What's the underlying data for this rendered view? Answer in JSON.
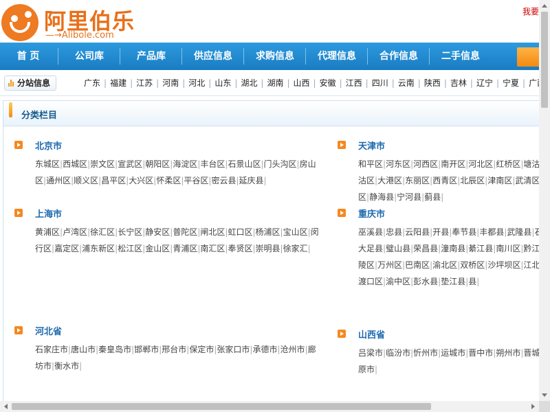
{
  "header": {
    "logo_cn": "阿里伯乐",
    "logo_en": "Alibole.com",
    "logo_arrow": "—→",
    "top_link": "我要"
  },
  "nav": {
    "items": [
      {
        "label": "首 页"
      },
      {
        "label": "公司库"
      },
      {
        "label": "产品库"
      },
      {
        "label": "供应信息"
      },
      {
        "label": "求购信息"
      },
      {
        "label": "代理信息"
      },
      {
        "label": "合作信息"
      },
      {
        "label": "二手信息"
      }
    ]
  },
  "region_bar": {
    "label": "分站信息",
    "regions": [
      "广东",
      "福建",
      "江苏",
      "河南",
      "河北",
      "山东",
      "湖北",
      "湖南",
      "山西",
      "安徽",
      "江西",
      "四川",
      "云南",
      "陕西",
      "吉林",
      "辽宁",
      "宁夏",
      "广西"
    ]
  },
  "panel": {
    "title": "分类栏目",
    "blocks": [
      {
        "name": "北京市",
        "links": [
          "东城区",
          "西城区",
          "崇文区",
          "宣武区",
          "朝阳区",
          "海淀区",
          "丰台区",
          "石景山区",
          "门头沟区",
          "房山区",
          "通州区",
          "顺义区",
          "昌平区",
          "大兴区",
          "怀柔区",
          "平谷区",
          "密云县",
          "延庆县"
        ]
      },
      {
        "name": "天津市",
        "links": [
          "和平区",
          "河东区",
          "河西区",
          "南开区",
          "河北区",
          "红桥区",
          "塘沽区",
          "汉沽区",
          "大港区",
          "东丽区",
          "西青区",
          "北辰区",
          "津南区",
          "武清区",
          "宝坻区",
          "静海县",
          "宁河县",
          "蓟县"
        ]
      },
      {
        "name": "上海市",
        "links": [
          "黄浦区",
          "卢湾区",
          "徐汇区",
          "长宁区",
          "静安区",
          "普陀区",
          "闸北区",
          "虹口区",
          "杨浦区",
          "宝山区",
          "闵行区",
          "嘉定区",
          "浦东新区",
          "松江区",
          "金山区",
          "青浦区",
          "南汇区",
          "奉贤区",
          "崇明县",
          "徐家汇"
        ]
      },
      {
        "name": "重庆市",
        "links": [
          "巫溪县",
          "忠县",
          "云阳县",
          "开县",
          "奉节县",
          "丰都县",
          "武隆县",
          "石柱县",
          "大足县",
          "璧山县",
          "荣昌县",
          "潼南县",
          "綦江县",
          "南川区",
          "黔江区",
          "涪陵区",
          "万州区",
          "巴南区",
          "渝北区",
          "双桥区",
          "沙坪坝区",
          "江北区",
          "大渡口区",
          "渝中区",
          "彭水县",
          "垫江县",
          "县"
        ]
      },
      {
        "name": "河北省",
        "links": [
          "石家庄市",
          "唐山市",
          "秦皇岛市",
          "邯郸市",
          "邢台市",
          "保定市",
          "张家口市",
          "承德市",
          "沧州市",
          "廊坊市",
          "衡水市"
        ]
      },
      {
        "name": "山西省",
        "links": [
          "吕梁市",
          "临汾市",
          "忻州市",
          "运城市",
          "晋中市",
          "朔州市",
          "晋城市",
          "太原市"
        ]
      }
    ]
  }
}
